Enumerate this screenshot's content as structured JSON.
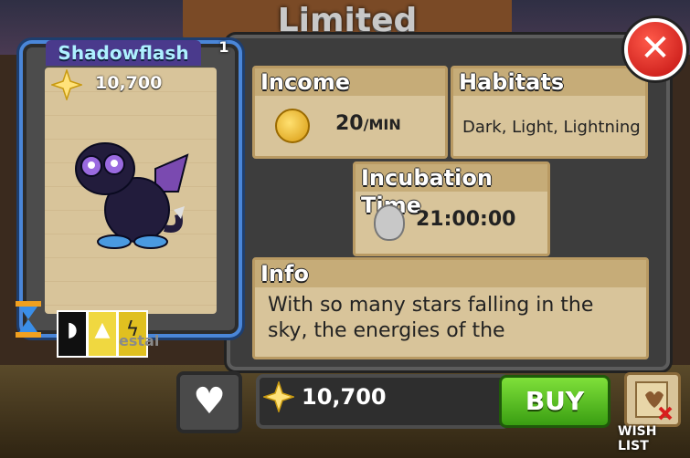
{
  "screen": {
    "title": "Limited"
  },
  "card": {
    "name": "Shadowflash",
    "count": "1",
    "price": "10,700",
    "elements": [
      "dark",
      "light",
      "lightning"
    ],
    "faded_label": "estal"
  },
  "stats": {
    "income_label": "Income",
    "income_value": "20",
    "income_unit": "/MIN",
    "habitats_label": "Habitats",
    "habitats_value": "Dark, Light, Lightning",
    "incubation_label": "Incubation Time",
    "incubation_value": "21:00:00",
    "info_label": "Info",
    "info_text": "With so many stars falling in the sky, the energies of the"
  },
  "actions": {
    "close_glyph": "✕",
    "favorite_glyph": "♥",
    "price": "10,700",
    "buy_label": "BUY",
    "wishlist_label": "WISH LIST"
  },
  "icons": {
    "star": "star-icon",
    "coin": "coin-icon",
    "egg": "egg-hourglass-icon",
    "heart": "heart-icon",
    "scroll": "scroll-icon"
  },
  "colors": {
    "card_border": "#4a86d8",
    "buy": "#5abf1f",
    "close": "#d81e1e",
    "parchment": "#d8c49a"
  }
}
